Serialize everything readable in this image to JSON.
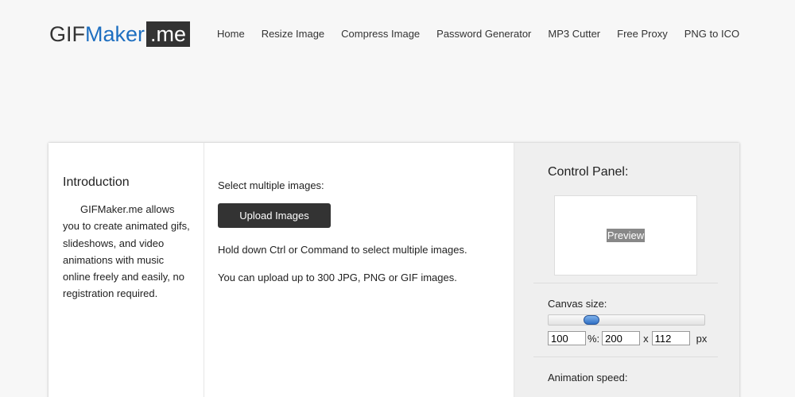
{
  "logo": {
    "part1": "GIF",
    "part2": "Maker",
    "part3": ".me"
  },
  "nav": [
    {
      "label": "Home"
    },
    {
      "label": "Resize Image"
    },
    {
      "label": "Compress Image"
    },
    {
      "label": "Password Generator"
    },
    {
      "label": "MP3 Cutter"
    },
    {
      "label": "Free Proxy"
    },
    {
      "label": "PNG to ICO"
    }
  ],
  "intro": {
    "title": "Introduction",
    "text": "GIFMaker.me allows you to create animated gifs, slideshows, and video animations with music online freely and easily, no registration required."
  },
  "upload": {
    "label": "Select multiple images:",
    "button": "Upload Images",
    "hint1": "Hold down Ctrl or Command to select multiple images.",
    "hint2": "You can upload up to 300 JPG, PNG or GIF images."
  },
  "panel": {
    "title": "Control Panel:",
    "preview": "Preview",
    "canvas_label": "Canvas size:",
    "slider_fraction": 0.25,
    "percent_value": "100",
    "percent_suffix": "%:",
    "width_value": "200",
    "x_sep": "x",
    "height_value": "112",
    "unit": "px",
    "speed_label": "Animation speed:"
  },
  "colors": {
    "logo_blue": "#1e6fc0",
    "button_dark": "#333333",
    "panel_bg": "#efefef"
  }
}
